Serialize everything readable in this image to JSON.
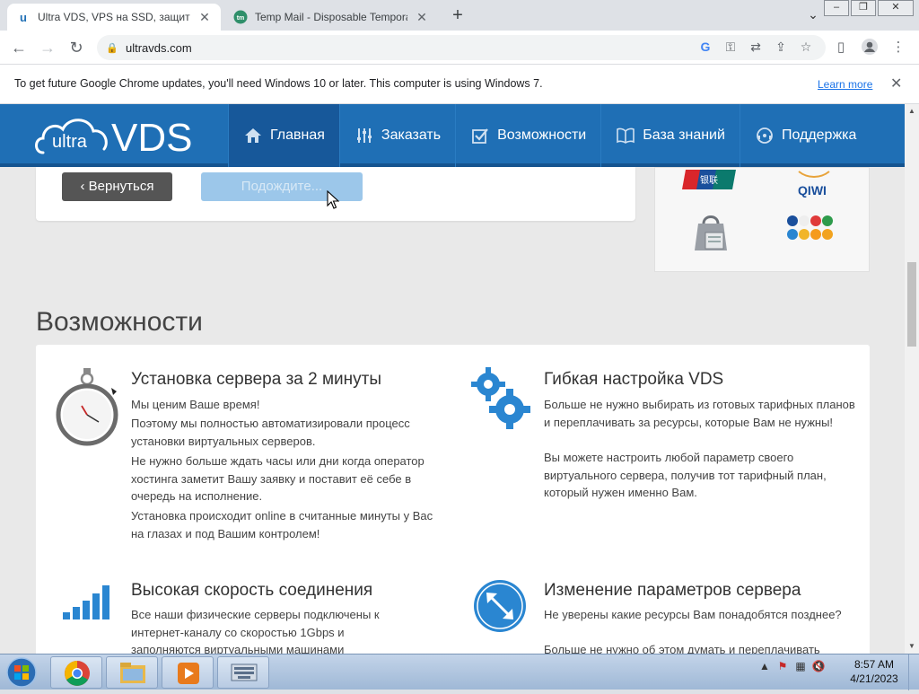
{
  "browser": {
    "tabs": [
      {
        "title": "Ultra VDS, VPS на SSD, защита о",
        "favicon": "u"
      },
      {
        "title": "Temp Mail - Disposable Tempora",
        "favicon": "tm"
      }
    ],
    "url": "ultravds.com"
  },
  "infobar": {
    "message": "To get future Google Chrome updates, you'll need Windows 10 or later. This computer is using Windows 7.",
    "link": "Learn more"
  },
  "site": {
    "logo_ultra": "ultra",
    "logo_vds": "VDS",
    "menu": [
      {
        "label": "Главная",
        "icon": "home-icon"
      },
      {
        "label": "Заказать",
        "icon": "sliders-icon"
      },
      {
        "label": "Возможности",
        "icon": "checkbox-icon"
      },
      {
        "label": "База знаний",
        "icon": "book-icon"
      },
      {
        "label": "Поддержка",
        "icon": "support-icon"
      }
    ]
  },
  "form": {
    "back_label": "‹ Вернуться",
    "wait_label": "Подождите..."
  },
  "payments": {
    "qiwi_label": "QIWI",
    "unionpay_label": "银联"
  },
  "features": {
    "section_title": "Возможности",
    "items": [
      {
        "title": "Установка сервера за 2 минуты",
        "paragraphs": [
          "Мы ценим Ваше время!",
          "Поэтому мы полностью автоматизировали процесс установки виртуальных серверов.",
          "Не нужно больше ждать часы или дни когда оператор хостинга заметит Вашу заявку и поставит её себе в очередь на исполнение.",
          "Установка происходит online в считанные минуты у Вас на глазах и под Вашим контролем!"
        ]
      },
      {
        "title": "Гибкая настройка VDS",
        "paragraphs": [
          "Больше не нужно выбирать из готовых тарифных планов и переплачивать за ресурсы, которые Вам не нужны!",
          "Вы можете настроить любой параметр своего виртуального сервера, получив тот тарифный план, который нужен именно Вам."
        ]
      },
      {
        "title": "Высокая скорость соединения",
        "paragraphs": [
          "Все наши физические серверы подключены к интернет-каналу со скоростью 1Gbps и заполняются виртуальными машинами"
        ]
      },
      {
        "title": "Изменение параметров сервера",
        "paragraphs": [
          "Не уверены какие ресурсы Вам понадобятся позднее?",
          "Больше не нужно об этом думать и переплачивать"
        ]
      }
    ]
  },
  "taskbar": {
    "time": "8:57 AM",
    "date": "4/21/2023"
  },
  "colors": {
    "brand_blue": "#1f6fb5",
    "brand_blue_dark": "#17589a",
    "icon_blue": "#2a86d1"
  }
}
